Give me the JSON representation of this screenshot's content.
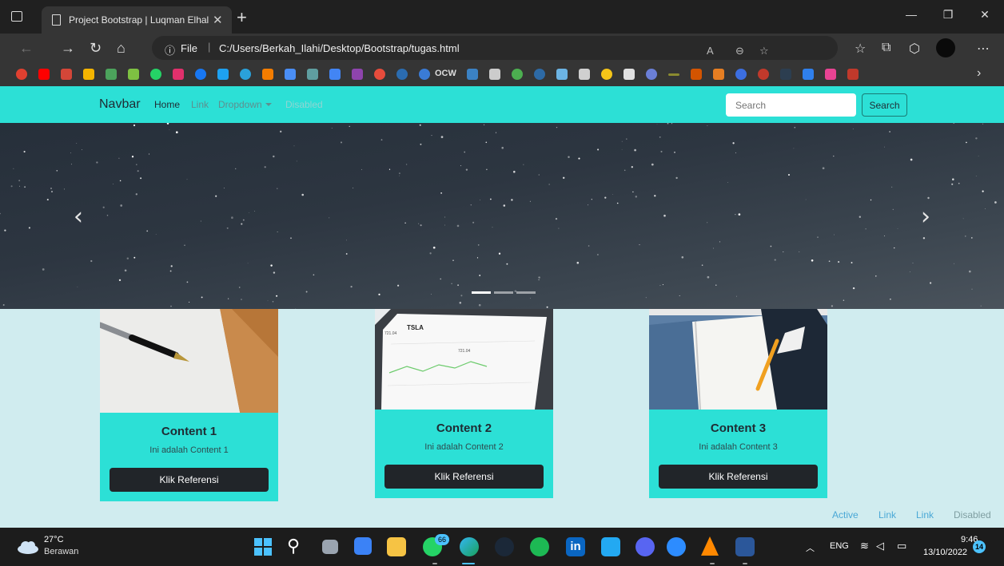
{
  "browser": {
    "tab_title": "Project Bootstrap | Luqman Elhal",
    "file_label": "File",
    "url": "C:/Users/Berkah_Ilahi/Desktop/Bootstrap/tugas.html",
    "bookmark_ocw": "OCW"
  },
  "navbar": {
    "brand": "Navbar",
    "links": [
      "Home",
      "Link",
      "Dropdown",
      "Disabled"
    ],
    "search_placeholder": "Search",
    "search_button": "Search"
  },
  "carousel": {
    "prev_icon": "‹",
    "next_icon": "›",
    "indicators": 3,
    "active_indicator": 0
  },
  "cards": [
    {
      "title": "Content 1",
      "text": "Ini adalah Content 1",
      "button": "Klik Referensi"
    },
    {
      "title": "Content 2",
      "text": "Ini adalah Content 2",
      "button": "Klik Referensi"
    },
    {
      "title": "Content 3",
      "text": "Ini adalah Content 3",
      "button": "Klik Referensi"
    }
  ],
  "footer_nav": [
    "Active",
    "Link",
    "Link",
    "Disabled"
  ],
  "taskbar": {
    "temperature": "27°C",
    "weather": "Berawan",
    "whatsapp_badge": "66",
    "language": "ENG",
    "time": "9:46",
    "date": "13/10/2022",
    "notifications": "14"
  },
  "colors": {
    "navbar_bg": "#2ce0d6",
    "page_bg": "#d0ecef",
    "button_dark": "#212529",
    "link_blue": "#4aa8d6"
  }
}
